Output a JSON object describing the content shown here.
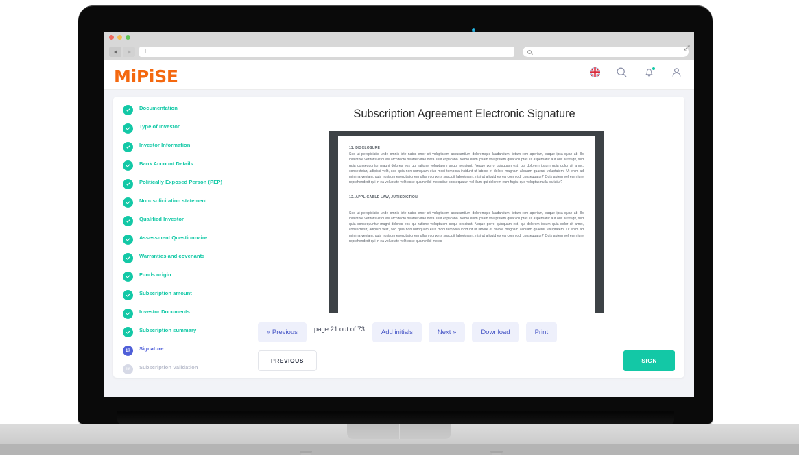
{
  "browser": {
    "traffic_lights": [
      "close",
      "minimize",
      "maximize"
    ],
    "back_icon": "back-arrow-icon",
    "forward_icon": "forward-arrow-icon",
    "url_placeholder": "+",
    "url_value": "",
    "search_placeholder": "",
    "search_value": "",
    "expand_icon": "expand-arrows-icon"
  },
  "header": {
    "logo": "MiPiSE",
    "icons": [
      {
        "name": "language-flag-icon",
        "label": "English"
      },
      {
        "name": "search-icon",
        "label": "Search"
      },
      {
        "name": "notifications-bell-icon",
        "label": "Notifications"
      },
      {
        "name": "user-account-icon",
        "label": "Account"
      }
    ],
    "notification_dot_color": "#13C8A6"
  },
  "sidebar": {
    "steps": [
      {
        "label": "Documentation",
        "state": "done",
        "badge": "check"
      },
      {
        "label": "Type of Investor",
        "state": "done",
        "badge": "check"
      },
      {
        "label": "Investor Information",
        "state": "done",
        "badge": "check"
      },
      {
        "label": "Bank Account Details",
        "state": "done",
        "badge": "check"
      },
      {
        "label": "Politically Exposed Person (PEP)",
        "state": "done",
        "badge": "check"
      },
      {
        "label": "Non- solicitation statement",
        "state": "done",
        "badge": "check"
      },
      {
        "label": "Qualified Investor",
        "state": "done",
        "badge": "check"
      },
      {
        "label": "Assessment Questionnaire",
        "state": "done",
        "badge": "check"
      },
      {
        "label": "Warranties and covenants",
        "state": "done",
        "badge": "check"
      },
      {
        "label": "Funds origin",
        "state": "done",
        "badge": "check"
      },
      {
        "label": "Subscription amount",
        "state": "done",
        "badge": "check"
      },
      {
        "label": "Investor Documents",
        "state": "done",
        "badge": "check"
      },
      {
        "label": "Subscription summary",
        "state": "done",
        "badge": "check"
      },
      {
        "label": "Signature",
        "state": "active",
        "badge": "17"
      },
      {
        "label": "Subscription Validation",
        "state": "todo",
        "badge": "18"
      }
    ],
    "colors": {
      "done": "#13C8A6",
      "active": "#4F5FD8",
      "todo": "#d6d9e6"
    }
  },
  "main": {
    "title": "Subscription Agreement Electronic Signature",
    "document": {
      "section1_heading": "11.  DISCLOSURE",
      "section1_body": "Sed ut perspiciatis unde omnis iste natus error sit voluptatem accusantium doloremque laudantium, totam rem aperiam, eaque ipsa quae ab illo inventore veritatis et quasi architecto beatae vitae dicta sunt explicabo. Nemo enim ipsam voluptatem quia voluptas sit aspernatur aut odit aut fugit, sed quia consequuntur magni dolores eos qui ratione voluptatem sequi nesciunt. Neque porro quisquam est, qui dolorem ipsum quia dolor sit amet, consectetur, adipisci velit, sed quia non numquam eius modi tempora incidunt ut labore et dolore magnam aliquam quaerat voluptatem. Ut enim ad minima veniam, quis nostrum exercitationem ullam corporis suscipit laboriosam, nisi ut aliquid ex ea commodi consequatur? Quis autem vel eum iure reprehenderit qui in ea voluptate velit esse quam nihil molestiae consequatur, vel illum qui dolorem eum fugiat quo voluptas nulla pariatur?",
      "section2_heading": "12. APPLICABLE LAW, JURISDICTION",
      "section2_body": "Sed ut perspiciatis unde omnis iste natus error sit voluptatem accusantium doloremque laudantium, totam rem aperiam, eaque ipsa quae ab illo inventore veritatis et quasi architecto beatae vitae dicta sunt explicabo. Nemo enim ipsam voluptatem quia voluptas sit aspernatur aut odit aut fugit, sed quia consequuntur magni dolores eos qui ratione voluptatem sequi nesciunt. Neque porro quisquam est, qui dolorem ipsum quia dolor sit amet, consectetur, adipisci velit, sed quia non numquam eius modi tempora incidunt ut labore et dolore magnam aliquam quaerat voluptatem. Ut enim ad minima veniam, quis nostrum exercitationem ullam corporis suscipit laboriosam, nisi ut aliquid ex ea commodi consequatur? Quis autem vel eum iure reprehenderit qui in ea voluptate velit esse quam nihil moles-"
    },
    "toolbar": {
      "previous_page": "« Previous",
      "page_indicator": "page 21 out of 73",
      "add_initials": "Add initials",
      "next_page": "Next »",
      "download": "Download",
      "print": "Print"
    },
    "footer": {
      "previous": "PREVIOUS",
      "sign": "SIGN",
      "sign_color": "#13C8A6"
    }
  }
}
